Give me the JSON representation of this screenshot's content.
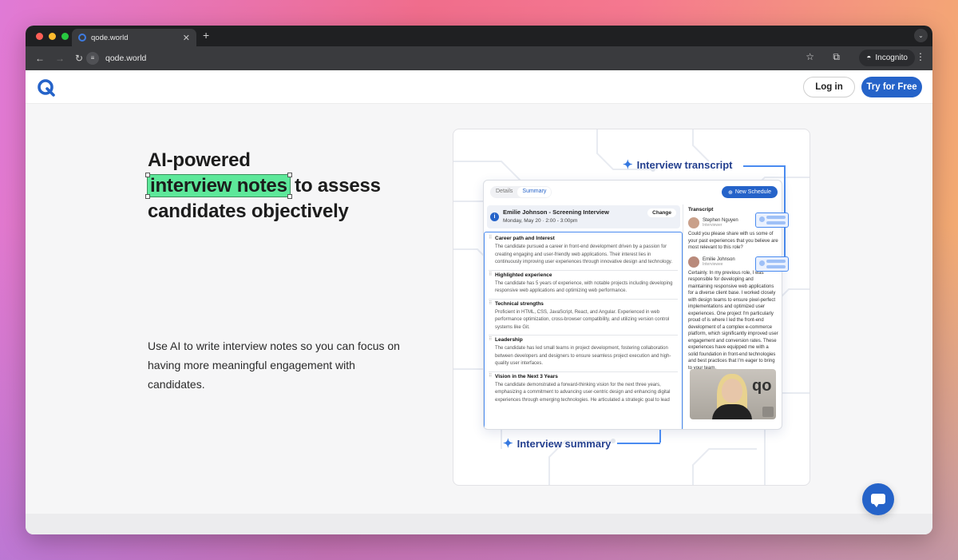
{
  "browser": {
    "tab_title": "qode.world",
    "url": "qode.world",
    "incognito_label": "Incognito"
  },
  "header": {
    "login_label": "Log in",
    "try_label": "Try for Free",
    "brand_color": "#2563c9"
  },
  "hero": {
    "title_line1": "AI-powered",
    "title_highlight": "interview notes",
    "title_line2_rest": " to assess",
    "title_line3": "candidates objectively",
    "subtitle": "Use AI to write interview notes so you can focus on having more meaningful engagement with candidates.",
    "highlight_color": "#5de89a"
  },
  "illustration": {
    "transcript_label": "Interview transcript",
    "summary_label": "Interview summary",
    "tabs": [
      "Details",
      "Summary"
    ],
    "new_schedule": "New Schedule",
    "interview_title": "Emilie Johnson - Screening Interview",
    "interview_time": "Monday, May 20 · 2:00 - 3:00pm",
    "change_label": "Change",
    "sections": [
      {
        "heading": "Career path and Interest",
        "body": "The candidate pursued a career in front-end development driven by a passion for creating engaging and user-friendly web applications. Their interest lies in continuously improving user experiences through innovative design and technology."
      },
      {
        "heading": "Highlighted experience",
        "body": "The candidate has 5 years of experience, with notable projects including developing responsive web applications and optimizing web performance."
      },
      {
        "heading": "Technical strengths",
        "body": "Proficient in HTML, CSS, JavaScript, React, and Angular. Experienced in web performance optimization, cross-browser compatibility, and utilizing version control systems like Git."
      },
      {
        "heading": "Leadership",
        "body": "The candidate has led small teams in project development, fostering collaboration between developers and designers to ensure seamless project execution and high-quality user interfaces."
      },
      {
        "heading": "Vision in the Next 3 Years",
        "body": "The candidate demonstrated a forward-thinking vision for the next three years, emphasizing a commitment to advancing user-centric design and enhancing digital experiences through emerging technologies. He articulated a strategic goal to lead"
      }
    ],
    "transcript": {
      "heading": "Transcript",
      "speaker1_name": "Stephen Nguyen",
      "speaker1_role": "Interviewer",
      "speaker1_text": "Could you please share with us some of your past experiences that you believe are most relevant to this role?",
      "speaker2_name": "Emilie Johnson",
      "speaker2_role": "Interviewee",
      "speaker2_text": "Certainly. In my previous role, I was responsible for developing and maintaining responsive web applications for a diverse client base. I worked closely with design teams to ensure pixel-perfect implementations and optimized user experiences. One project I'm particularly proud of is where I led the front-end development of a complex e-commerce platform, which significantly improved user engagement and conversion rates. These experiences have equipped me with a solid foundation in front-end technologies and best practices that I'm eager to bring to your team."
    }
  }
}
